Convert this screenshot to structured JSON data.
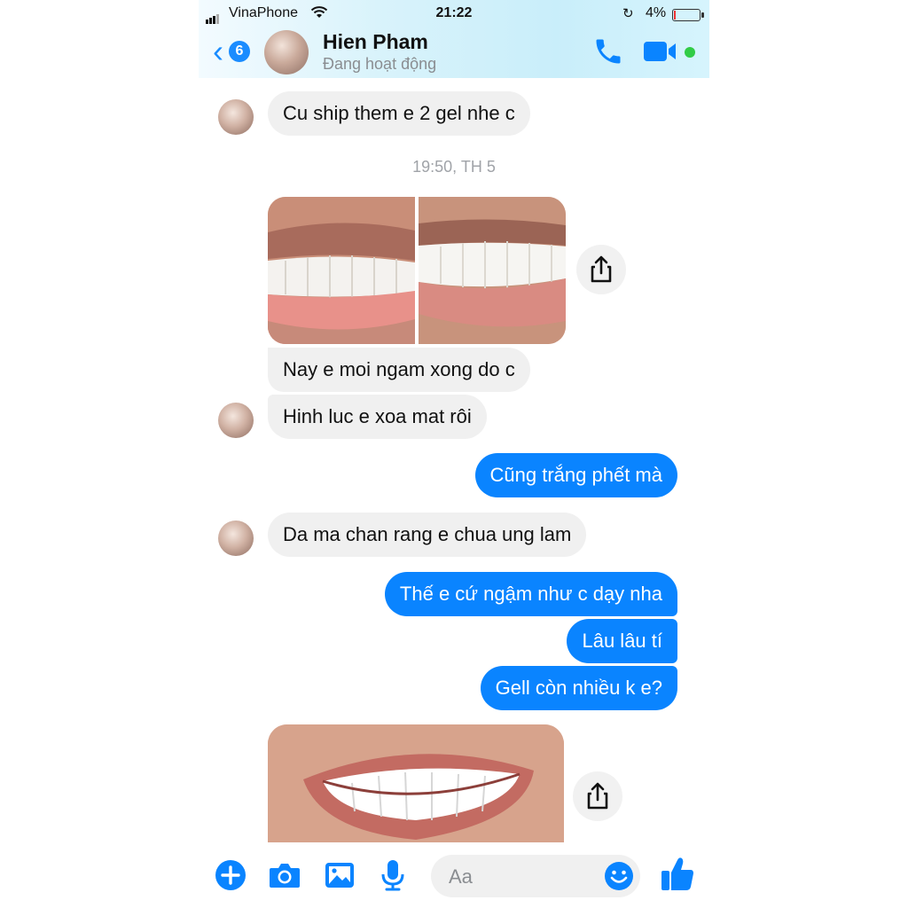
{
  "status_bar": {
    "carrier": "VinaPhone",
    "time": "21:22",
    "battery": "4%"
  },
  "header": {
    "back_count": "6",
    "contact_name": "Hien Pham",
    "contact_status": "Đang hoạt động"
  },
  "messages": {
    "m1": "Cu ship them e 2 gel nhe c",
    "timestamp": "19:50, TH 5",
    "m2": "Nay e moi ngam xong do c",
    "m3": "Hinh luc e xoa mat rôi",
    "m4": "Cũng trắng phết mà",
    "m5": "Da ma chan rang e chua ung lam",
    "m6": "Thế e cứ ngậm như c dạy nha",
    "m7": "Lâu lâu tí",
    "m8": "Gell còn nhiều k e?"
  },
  "composer": {
    "placeholder": "Aa"
  },
  "colors": {
    "accent": "#0a84ff",
    "incoming_bubble": "#f0f0f0",
    "online": "#31cc46"
  },
  "icons": [
    "signal-icon",
    "wifi-icon",
    "lock-rotation-icon",
    "battery-icon",
    "back-chevron-icon",
    "phone-icon",
    "video-icon",
    "share-icon",
    "plus-icon",
    "camera-icon",
    "gallery-icon",
    "microphone-icon",
    "emoji-icon",
    "like-icon"
  ]
}
